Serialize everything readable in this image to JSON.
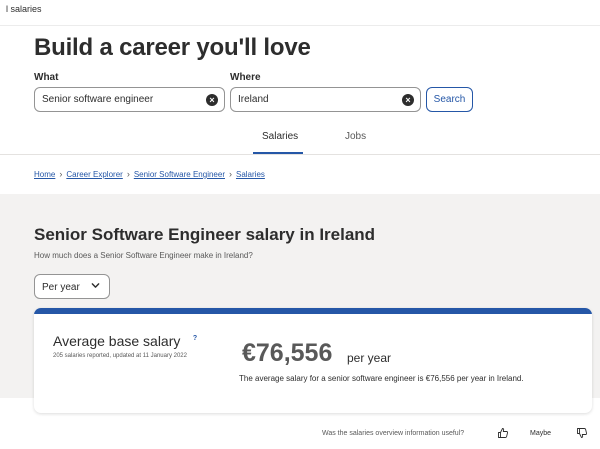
{
  "top_strip": {
    "text": "l salaries"
  },
  "hero": {
    "title": "Build a career you'll love"
  },
  "search": {
    "what_label": "What",
    "what_value": "Senior software engineer",
    "where_label": "Where",
    "where_value": "Ireland",
    "button_label": "Search"
  },
  "tabs": [
    {
      "label": "Salaries",
      "active": true
    },
    {
      "label": "Jobs",
      "active": false
    }
  ],
  "breadcrumb": [
    "Home",
    "Career Explorer",
    "Senior Software Engineer",
    "Salaries"
  ],
  "salary": {
    "title": "Senior Software Engineer salary in Ireland",
    "subtitle": "How much does a Senior Software Engineer make in Ireland?",
    "period": "Per year",
    "avg_label": "Average base salary",
    "help_glyph": "?",
    "meta": "205 salaries reported, updated at 11 January 2022",
    "amount": "€76,556",
    "per_year": "per year",
    "description": "The average salary for a senior software engineer is €76,556 per year in Ireland."
  },
  "feedback": {
    "question": "Was the salaries overview information useful?",
    "maybe_label": "Maybe"
  },
  "colors": {
    "accent": "#2557a7",
    "text": "#2d2d2d",
    "muted": "#595959",
    "section_bg": "#f3f2f1"
  },
  "icons": {
    "clear": "close-circle-icon",
    "chevron": "chevron-down-icon",
    "help": "question-icon",
    "up": "thumbs-up-icon",
    "down": "thumbs-down-icon"
  }
}
